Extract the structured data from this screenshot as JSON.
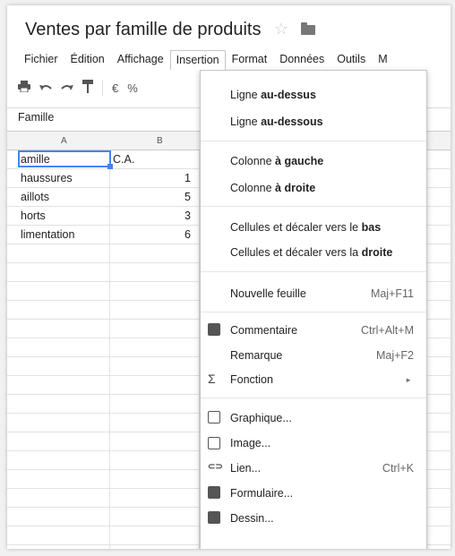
{
  "doc": {
    "title": "Ventes par famille de produits",
    "star": "☆"
  },
  "menu": [
    "Fichier",
    "Édition",
    "Affichage",
    "Insertion",
    "Format",
    "Données",
    "Outils",
    "M"
  ],
  "toolbar": {
    "euro": "€",
    "percent": "%"
  },
  "formula_bar": {
    "value": "Famille"
  },
  "columns": [
    "A",
    "B"
  ],
  "rows": [
    {
      "a": "amille",
      "b": "C.A."
    },
    {
      "a": "haussures",
      "b": "1"
    },
    {
      "a": "aillots",
      "b": "5"
    },
    {
      "a": "horts",
      "b": "3"
    },
    {
      "a": "limentation",
      "b": "6"
    }
  ],
  "dropdown": {
    "insert_row_above": {
      "pre": "Ligne ",
      "bold": "au-dessus",
      "post": ""
    },
    "insert_row_below": {
      "pre": "Ligne ",
      "bold": "au-dessous",
      "post": ""
    },
    "insert_col_left": {
      "pre": "Colonne ",
      "bold": "à gauche",
      "post": ""
    },
    "insert_col_right": {
      "pre": "Colonne ",
      "bold": "à droite",
      "post": ""
    },
    "insert_cells_down": {
      "pre": "Cellules et décaler vers le ",
      "bold": "bas",
      "post": ""
    },
    "insert_cells_right": {
      "pre": "Cellules et décaler vers la ",
      "bold": "droite",
      "post": ""
    },
    "new_sheet": {
      "label": "Nouvelle feuille",
      "shortcut": "Maj+F11"
    },
    "comment": {
      "label": "Commentaire",
      "shortcut": "Ctrl+Alt+M"
    },
    "note": {
      "label": "Remarque",
      "shortcut": "Maj+F2"
    },
    "function": {
      "label": "Fonction",
      "icon": "Σ",
      "arrow": "►"
    },
    "chart": {
      "label": "Graphique..."
    },
    "image": {
      "label": "Image..."
    },
    "link": {
      "label": "Lien...",
      "shortcut": "Ctrl+K",
      "icon": "⊂⊃"
    },
    "form": {
      "label": "Formulaire..."
    },
    "drawing": {
      "label": "Dessin..."
    }
  }
}
